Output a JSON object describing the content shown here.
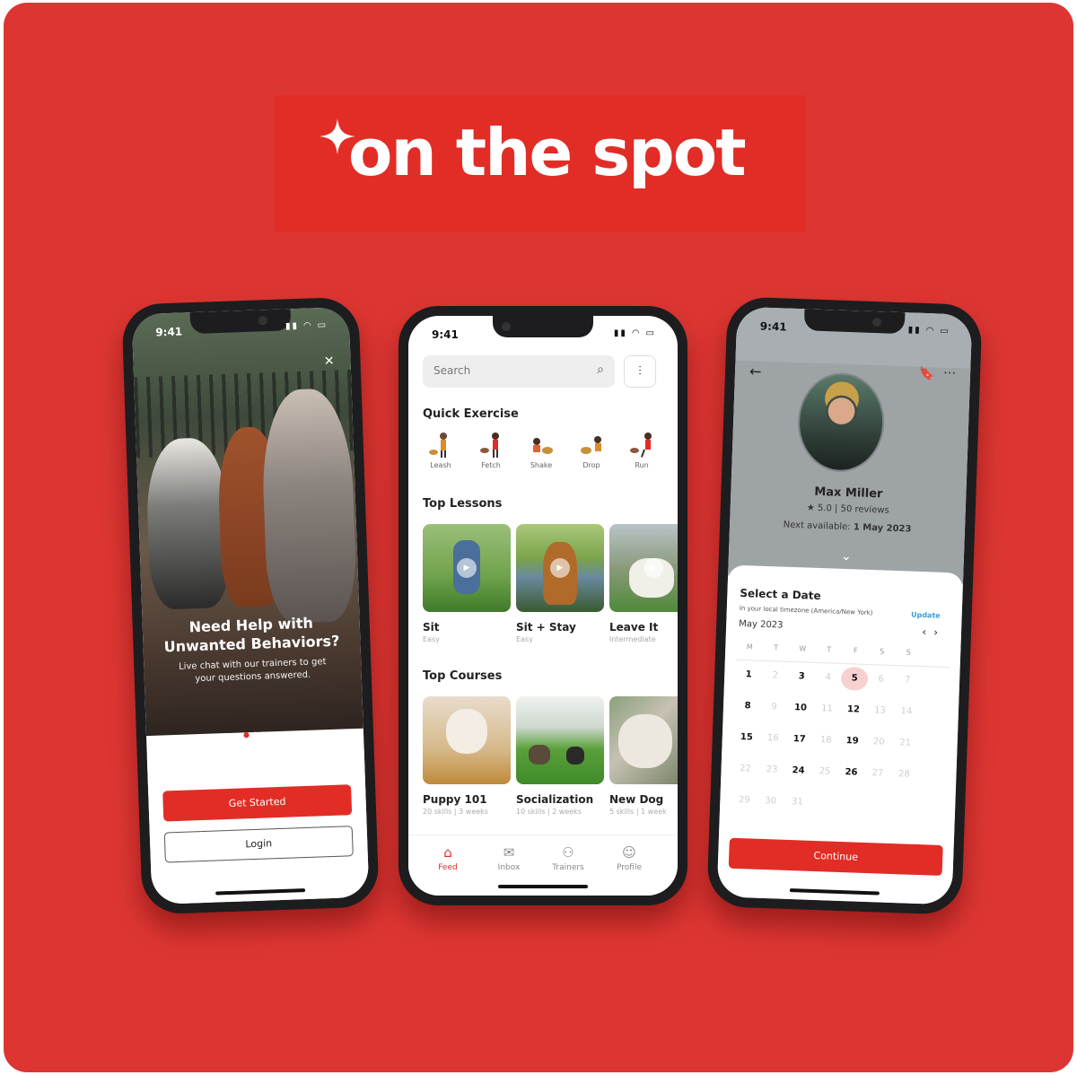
{
  "brand": {
    "name": "on the spot",
    "bg_color": "#dd3632",
    "accent": "#e12d26"
  },
  "left": {
    "time": "9:41",
    "hero_title": "Need Help with Unwanted Behaviors?",
    "hero_sub": "Live chat with our trainers to get your questions answered.",
    "primary_button": "Get Started",
    "secondary_button": "Login"
  },
  "center": {
    "time": "9:41",
    "search_placeholder": "Search",
    "quick_exercise_title": "Quick Exercise",
    "quick_exercises": [
      "Leash",
      "Fetch",
      "Shake",
      "Drop",
      "Run"
    ],
    "top_lessons_title": "Top Lessons",
    "lessons": [
      {
        "title": "Sit",
        "level": "Easy"
      },
      {
        "title": "Sit + Stay",
        "level": "Easy"
      },
      {
        "title": "Leave It",
        "level": "Intermediate"
      }
    ],
    "top_courses_title": "Top Courses",
    "courses": [
      {
        "title": "Puppy 101",
        "meta": "20 skills | 3 weeks"
      },
      {
        "title": "Socialization",
        "meta": "10 skills | 2 weeks"
      },
      {
        "title": "New Dog",
        "meta": "5 skills | 1 week"
      }
    ],
    "tabs": [
      "Feed",
      "Inbox",
      "Trainers",
      "Profile"
    ]
  },
  "right": {
    "time": "9:41",
    "trainer_name": "Max Miller",
    "rating": "★ 5.0 | 50 reviews",
    "next_available_label": "Next available:",
    "next_available_date": "1 May 2023",
    "sheet_title": "Select a Date",
    "timezone": "In your local timezone (America/New York)",
    "update_label": "Update",
    "month": "May 2023",
    "weekdays": [
      "M",
      "T",
      "W",
      "T",
      "F",
      "S",
      "S"
    ],
    "selected_day": "5",
    "weeks": [
      [
        "1",
        "2",
        "3",
        "4",
        "5",
        "6",
        "7"
      ],
      [
        "8",
        "9",
        "10",
        "11",
        "12",
        "13",
        "14"
      ],
      [
        "15",
        "16",
        "17",
        "18",
        "19",
        "20",
        "21"
      ],
      [
        "22",
        "23",
        "24",
        "25",
        "26",
        "27",
        "28"
      ],
      [
        "29",
        "30",
        "31",
        "",
        "",
        "",
        ""
      ]
    ],
    "available_days": [
      "1",
      "3",
      "5",
      "8",
      "10",
      "12",
      "15",
      "17",
      "19",
      "24",
      "26"
    ],
    "continue_label": "Continue"
  }
}
